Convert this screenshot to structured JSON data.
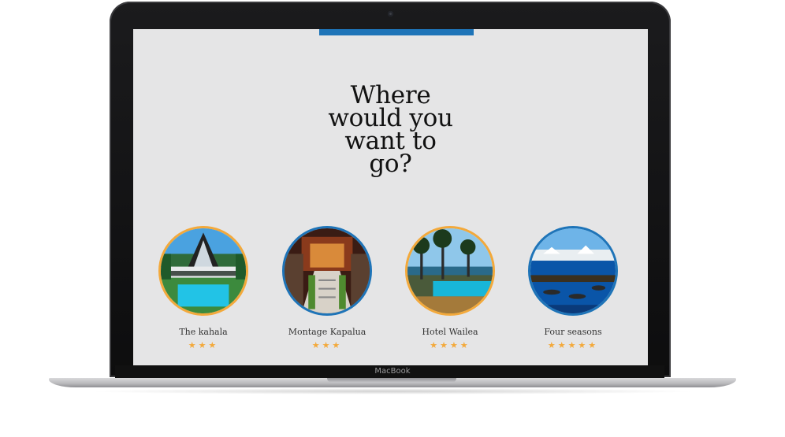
{
  "device": {
    "brand_label": "MacBook"
  },
  "page": {
    "headline_lines": [
      "Where",
      "would you",
      "want to",
      "go?"
    ],
    "accent_color": "#1e74b8",
    "highlight_color": "#f3a93b"
  },
  "hotels": [
    {
      "name": "The kahala",
      "rating": 3,
      "stars": "★★★",
      "ring": "#f3a93b"
    },
    {
      "name": "Montage Kapalua",
      "rating": 3,
      "stars": "★★★",
      "ring": "#1e74b8"
    },
    {
      "name": "Hotel Wailea",
      "rating": 4,
      "stars": "★★★★",
      "ring": "#f3a93b"
    },
    {
      "name": "Four seasons",
      "rating": 5,
      "stars": "★★★★★",
      "ring": "#1e74b8"
    }
  ]
}
